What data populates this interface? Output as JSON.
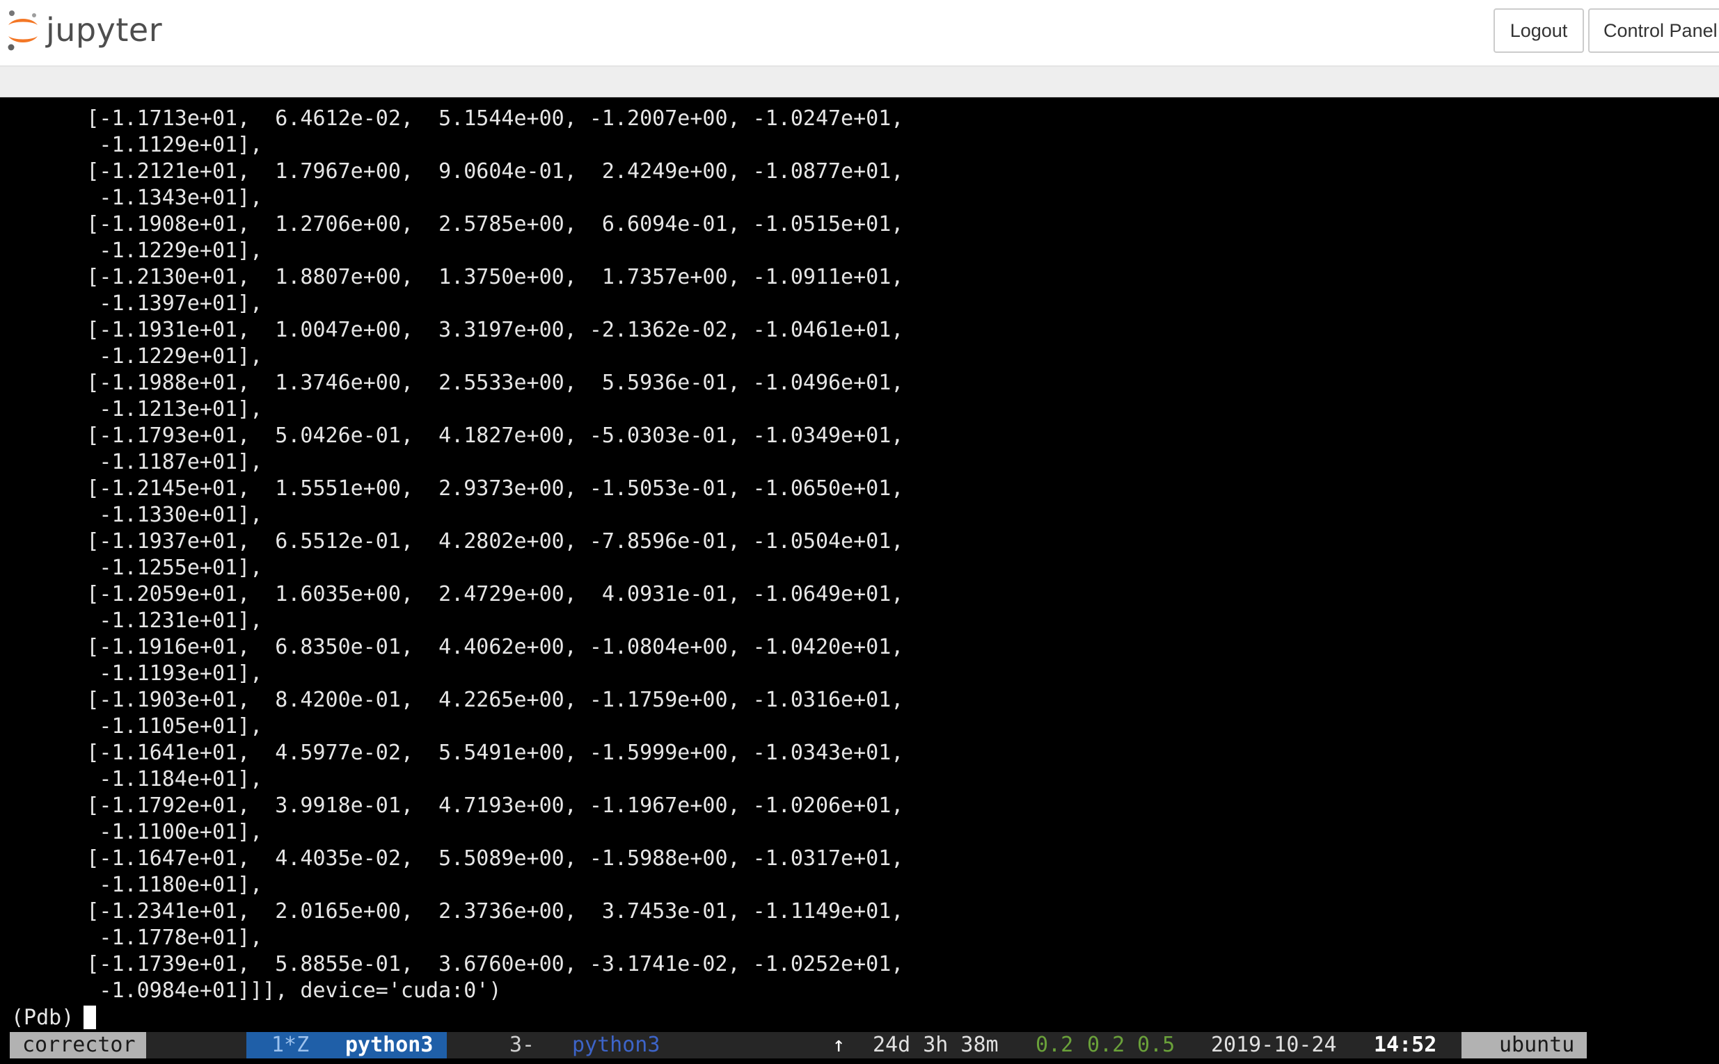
{
  "header": {
    "logo_text": "jupyter",
    "logout_label": "Logout",
    "control_panel_label": "Control Panel"
  },
  "colors": {
    "logo_orange": "#F37726",
    "logo_gray": "#9E9E9E",
    "status_active_window": "#1F5FA8",
    "status_session_bg": "#B2B2B2",
    "status_load_green": "#6AA13A"
  },
  "terminal": {
    "lines": [
      "      [-1.1713e+01,  6.4612e-02,  5.1544e+00, -1.2007e+00, -1.0247e+01,",
      "       -1.1129e+01],",
      "      [-1.2121e+01,  1.7967e+00,  9.0604e-01,  2.4249e+00, -1.0877e+01,",
      "       -1.1343e+01],",
      "      [-1.1908e+01,  1.2706e+00,  2.5785e+00,  6.6094e-01, -1.0515e+01,",
      "       -1.1229e+01],",
      "      [-1.2130e+01,  1.8807e+00,  1.3750e+00,  1.7357e+00, -1.0911e+01,",
      "       -1.1397e+01],",
      "      [-1.1931e+01,  1.0047e+00,  3.3197e+00, -2.1362e-02, -1.0461e+01,",
      "       -1.1229e+01],",
      "      [-1.1988e+01,  1.3746e+00,  2.5533e+00,  5.5936e-01, -1.0496e+01,",
      "       -1.1213e+01],",
      "      [-1.1793e+01,  5.0426e-01,  4.1827e+00, -5.0303e-01, -1.0349e+01,",
      "       -1.1187e+01],",
      "      [-1.2145e+01,  1.5551e+00,  2.9373e+00, -1.5053e-01, -1.0650e+01,",
      "       -1.1330e+01],",
      "      [-1.1937e+01,  6.5512e-01,  4.2802e+00, -7.8596e-01, -1.0504e+01,",
      "       -1.1255e+01],",
      "      [-1.2059e+01,  1.6035e+00,  2.4729e+00,  4.0931e-01, -1.0649e+01,",
      "       -1.1231e+01],",
      "      [-1.1916e+01,  6.8350e-01,  4.4062e+00, -1.0804e+00, -1.0420e+01,",
      "       -1.1193e+01],",
      "      [-1.1903e+01,  8.4200e-01,  4.2265e+00, -1.1759e+00, -1.0316e+01,",
      "       -1.1105e+01],",
      "      [-1.1641e+01,  4.5977e-02,  5.5491e+00, -1.5999e+00, -1.0343e+01,",
      "       -1.1184e+01],",
      "      [-1.1792e+01,  3.9918e-01,  4.7193e+00, -1.1967e+00, -1.0206e+01,",
      "       -1.1100e+01],",
      "      [-1.1647e+01,  4.4035e-02,  5.5089e+00, -1.5988e+00, -1.0317e+01,",
      "       -1.1180e+01],",
      "      [-1.2341e+01,  2.0165e+00,  2.3736e+00,  3.7453e-01, -1.1149e+01,",
      "       -1.1778e+01],",
      "      [-1.1739e+01,  5.8855e-01,  3.6760e+00, -3.1741e-02, -1.0252e+01,",
      "       -1.0984e+01]]], device='cuda:0')"
    ],
    "prompt": "(Pdb)"
  },
  "statusbar": {
    "session": "corrector",
    "active_window_index": "1*Z",
    "active_window_name": "python3",
    "inactive_window_index": "3-",
    "inactive_window_name": "python3",
    "arrow": "↑",
    "uptime": "24d 3h 38m",
    "load": [
      "0.2",
      "0.2",
      "0.5"
    ],
    "date": "2019-10-24",
    "time": "14:52",
    "host": "ubuntu"
  }
}
